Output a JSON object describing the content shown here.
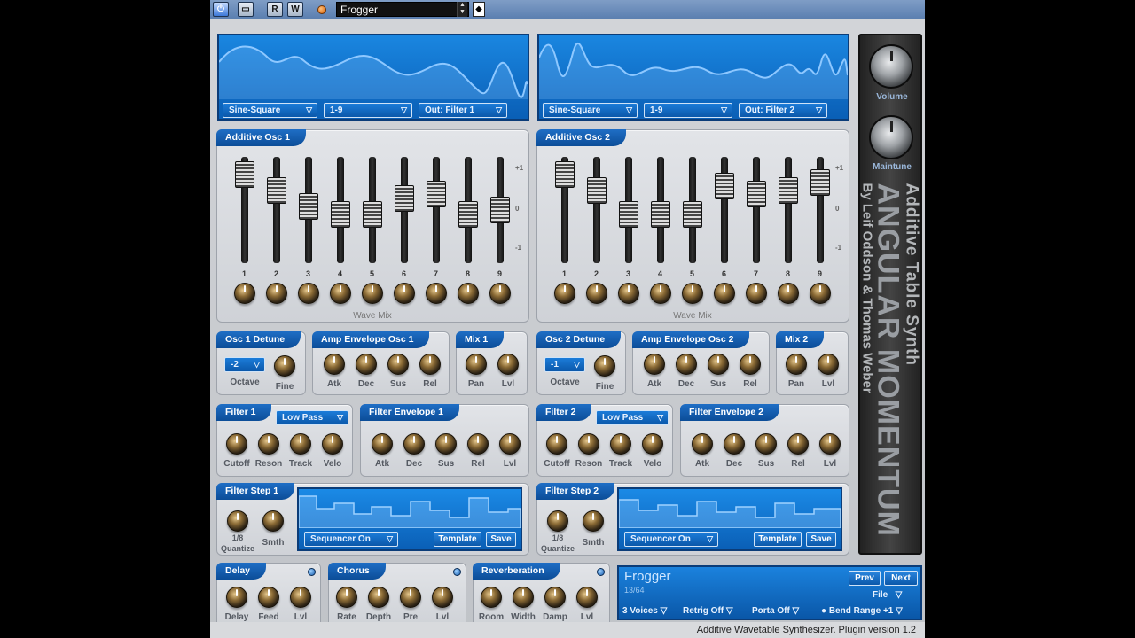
{
  "host": {
    "preset_name": "Frogger",
    "buttons": [
      "R",
      "W"
    ]
  },
  "osc_display": [
    {
      "wave": "Sine-Square",
      "range": "1-9",
      "out": "Out: Filter 1"
    },
    {
      "wave": "Sine-Square",
      "range": "1-9",
      "out": "Out: Filter 2"
    }
  ],
  "additive": [
    {
      "title": "Additive Osc 1",
      "footer": "Wave Mix",
      "levels": [
        0.95,
        0.75,
        0.55,
        0.45,
        0.45,
        0.65,
        0.7,
        0.45,
        0.5
      ]
    },
    {
      "title": "Additive Osc 2",
      "footer": "Wave Mix",
      "levels": [
        0.95,
        0.75,
        0.45,
        0.45,
        0.45,
        0.8,
        0.7,
        0.75,
        0.85
      ]
    }
  ],
  "slot_numbers": [
    "1",
    "2",
    "3",
    "4",
    "5",
    "6",
    "7",
    "8",
    "9"
  ],
  "scale": {
    "top": "+1",
    "mid": "0",
    "bot": "-1"
  },
  "osc1": {
    "detune": {
      "title": "Osc 1 Detune",
      "octave_value": "-2",
      "labels": [
        "Octave",
        "Fine"
      ]
    },
    "amp_env": {
      "title": "Amp Envelope Osc 1",
      "labels": [
        "Atk",
        "Dec",
        "Sus",
        "Rel"
      ]
    },
    "mix": {
      "title": "Mix 1",
      "labels": [
        "Pan",
        "Lvl"
      ]
    },
    "filter": {
      "title": "Filter 1",
      "type": "Low Pass",
      "labels": [
        "Cutoff",
        "Reson",
        "Track",
        "Velo"
      ]
    },
    "filter_env": {
      "title": "Filter Envelope 1",
      "labels": [
        "Atk",
        "Dec",
        "Sus",
        "Rel",
        "Lvl"
      ]
    },
    "step": {
      "title": "Filter Step 1",
      "quantize": "1/8",
      "labels": [
        "Quantize",
        "Smth"
      ],
      "seq": "Sequencer On",
      "template": "Template",
      "save": "Save"
    }
  },
  "osc2": {
    "detune": {
      "title": "Osc 2 Detune",
      "octave_value": "-1",
      "labels": [
        "Octave",
        "Fine"
      ]
    },
    "amp_env": {
      "title": "Amp Envelope Osc 2",
      "labels": [
        "Atk",
        "Dec",
        "Sus",
        "Rel"
      ]
    },
    "mix": {
      "title": "Mix 2",
      "labels": [
        "Pan",
        "Lvl"
      ]
    },
    "filter": {
      "title": "Filter 2",
      "type": "Low Pass",
      "labels": [
        "Cutoff",
        "Reson",
        "Track",
        "Velo"
      ]
    },
    "filter_env": {
      "title": "Filter Envelope 2",
      "labels": [
        "Atk",
        "Dec",
        "Sus",
        "Rel",
        "Lvl"
      ]
    },
    "step": {
      "title": "Filter Step 2",
      "quantize": "1/8",
      "labels": [
        "Quantize",
        "Smth"
      ],
      "seq": "Sequencer On",
      "template": "Template",
      "save": "Save"
    }
  },
  "fx": {
    "delay": {
      "title": "Delay",
      "labels": [
        "Delay",
        "Feed",
        "Lvl"
      ]
    },
    "chorus": {
      "title": "Chorus",
      "labels": [
        "Rate",
        "Depth",
        "Pre",
        "Lvl"
      ]
    },
    "reverb": {
      "title": "Reverberation",
      "labels": [
        "Room",
        "Width",
        "Damp",
        "Lvl"
      ]
    }
  },
  "sidebar": {
    "volume": "Volume",
    "maintune": "Maintune",
    "title1": "Additive Table Synth",
    "title2": "ANGULAR MOMENTUM",
    "title3": "By Leif Oddson & Thomas Weber"
  },
  "preset": {
    "name": "Frogger",
    "index": "13/64",
    "prev": "Prev",
    "next": "Next",
    "file": "File",
    "voices": "3 Voices",
    "retrig": "Retrig Off",
    "porta": "Porta Off",
    "bend": "Bend Range +1"
  },
  "footer": "Additive Wavetable Synthesizer. Plugin version 1.2"
}
